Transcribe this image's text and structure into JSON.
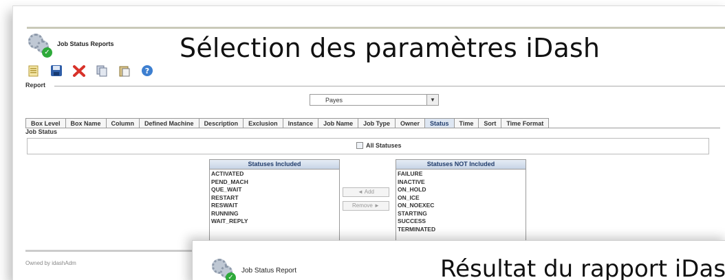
{
  "overlay": {
    "title_top": "Sélection des paramètres iDash",
    "title_bottom": "Résultat du rapport iDash"
  },
  "app": {
    "title": "Job Status Reports",
    "title_result": "Job Status Report",
    "logo_icon": "gears-check-icon"
  },
  "toolbar": {
    "icons": [
      "new-document-icon",
      "save-icon",
      "delete-icon",
      "copy-icon",
      "paste-icon",
      "help-icon"
    ]
  },
  "report": {
    "label": "Report",
    "selected": "Payes"
  },
  "tabs": [
    {
      "label": "Box Level"
    },
    {
      "label": "Box Name"
    },
    {
      "label": "Column"
    },
    {
      "label": "Defined Machine"
    },
    {
      "label": "Description"
    },
    {
      "label": "Exclusion"
    },
    {
      "label": "Instance"
    },
    {
      "label": "Job Name"
    },
    {
      "label": "Job Type"
    },
    {
      "label": "Owner"
    },
    {
      "label": "Status",
      "active": true
    },
    {
      "label": "Time"
    },
    {
      "label": "Sort"
    },
    {
      "label": "Time Format"
    }
  ],
  "job_status": {
    "label": "Job Status",
    "all_statuses": "All Statuses",
    "included_header": "Statuses Included",
    "included": [
      "ACTIVATED",
      "PEND_MACH",
      "QUE_WAIT",
      "RESTART",
      "RESWAIT",
      "RUNNING",
      "WAIT_REPLY"
    ],
    "not_included_header": "Statuses NOT Included",
    "not_included": [
      "FAILURE",
      "INACTIVE",
      "ON_HOLD",
      "ON_ICE",
      "ON_NOEXEC",
      "STARTING",
      "SUCCESS",
      "TERMINATED"
    ],
    "add_label": "◄ Add",
    "remove_label": "Remove ►"
  },
  "footer": {
    "owned_by": "Owned by idashAdm"
  },
  "colors": {
    "active_tab": "#dde6f2",
    "header_text": "#203c6b",
    "check_green": "#2eaa3a"
  }
}
